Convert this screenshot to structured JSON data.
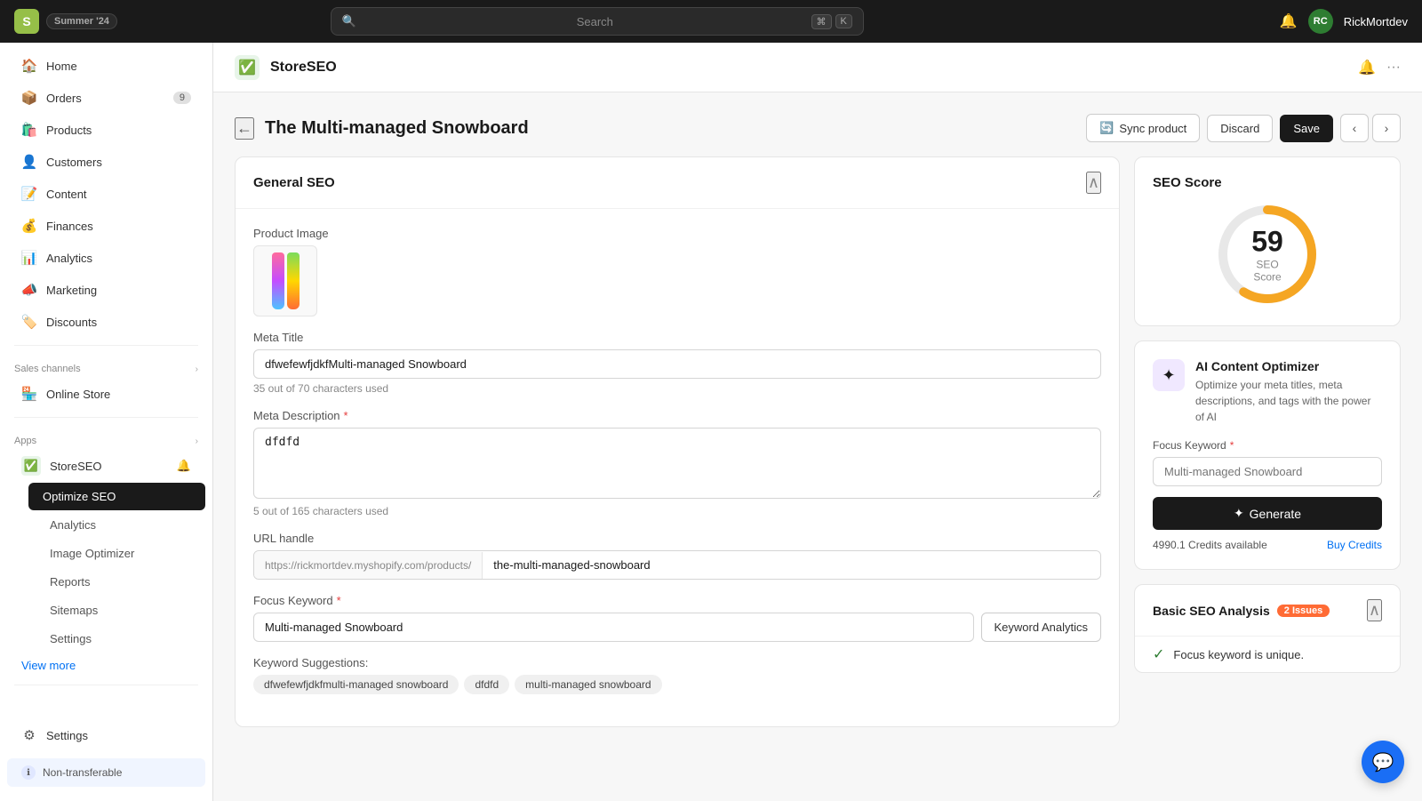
{
  "topbar": {
    "logo": "S",
    "store_name": "Summer '24",
    "search_placeholder": "Search",
    "shortcut_key": "K",
    "shortcut_meta": "⌘",
    "username": "RickMortdev"
  },
  "sidebar": {
    "nav_items": [
      {
        "id": "home",
        "label": "Home",
        "icon": "🏠"
      },
      {
        "id": "orders",
        "label": "Orders",
        "icon": "📦",
        "badge": "9"
      },
      {
        "id": "products",
        "label": "Products",
        "icon": "🛍️"
      },
      {
        "id": "customers",
        "label": "Customers",
        "icon": "👤"
      },
      {
        "id": "content",
        "label": "Content",
        "icon": "📝"
      },
      {
        "id": "finances",
        "label": "Finances",
        "icon": "💰"
      },
      {
        "id": "analytics",
        "label": "Analytics",
        "icon": "📊"
      },
      {
        "id": "marketing",
        "label": "Marketing",
        "icon": "📣"
      },
      {
        "id": "discounts",
        "label": "Discounts",
        "icon": "🏷️"
      }
    ],
    "sales_channels_label": "Sales channels",
    "online_store_label": "Online Store",
    "apps_label": "Apps",
    "store_seo_label": "StoreSEO",
    "optimize_seo_label": "Optimize SEO",
    "analytics_sub_label": "Analytics",
    "image_optimizer_label": "Image Optimizer",
    "reports_label": "Reports",
    "sitemaps_label": "Sitemaps",
    "settings_sub_label": "Settings",
    "view_more_label": "View more",
    "settings_label": "Settings",
    "non_transferable_label": "Non-transferable"
  },
  "app_header": {
    "title": "StoreSEO"
  },
  "page": {
    "title": "The Multi-managed Snowboard",
    "sync_label": "Sync product",
    "discard_label": "Discard",
    "save_label": "Save"
  },
  "general_seo": {
    "section_title": "General SEO",
    "product_image_label": "Product Image",
    "meta_title_label": "Meta Title",
    "meta_title_value": "dfwefewfjdkfMulti-managed Snowboard",
    "meta_title_chars": "35 out of 70 characters used",
    "meta_desc_label": "Meta Description",
    "meta_desc_value": "dfdfd",
    "meta_desc_chars": "5 out of 165 characters used",
    "url_handle_label": "URL handle",
    "url_prefix": "https://rickmortdev.myshopify.com/products/",
    "url_suffix": "the-multi-managed-snowboard",
    "focus_keyword_label": "Focus Keyword",
    "focus_keyword_value": "Multi-managed Snowboard",
    "keyword_analytics_label": "Keyword Analytics",
    "keyword_suggestions_label": "Keyword Suggestions:",
    "keyword_chips": [
      "dfwefewfjdkfmulti-managed snowboard",
      "dfdfd",
      "multi-managed snowboard"
    ]
  },
  "seo_score": {
    "title": "SEO Score",
    "score": "59",
    "score_label": "SEO Score",
    "score_value": 59,
    "score_max": 100,
    "color": "#f5a623",
    "track_color": "#e8e8e8"
  },
  "ai_optimizer": {
    "title": "AI Content Optimizer",
    "description": "Optimize your meta titles, meta descriptions, and tags with the power of AI",
    "focus_keyword_label": "Focus Keyword",
    "focus_keyword_placeholder": "Multi-managed Snowboard",
    "generate_label": "Generate",
    "credits_label": "4990.1 Credits available",
    "buy_credits_label": "Buy Credits"
  },
  "basic_seo": {
    "title": "Basic SEO Analysis",
    "issues_count": "2 Issues",
    "checks": [
      {
        "status": "ok",
        "text": "Focus keyword is unique."
      }
    ]
  },
  "icons": {
    "search": "🔍",
    "bell": "🔔",
    "back_arrow": "←",
    "chevron_up": "∧",
    "chevron_left": "‹",
    "chevron_right": "›",
    "sparkle": "✦",
    "chat": "💬",
    "gear": "⚙"
  }
}
